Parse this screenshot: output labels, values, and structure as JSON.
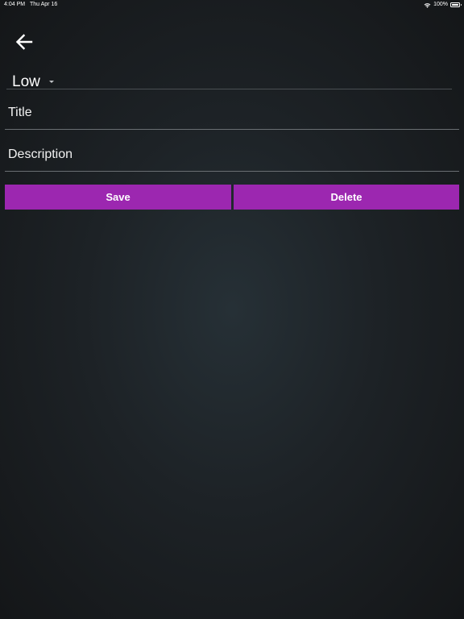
{
  "status_bar": {
    "time": "4:04 PM",
    "date": "Thu Apr 16",
    "battery": "100%",
    "battery_level": 1.0
  },
  "header": {
    "back_icon": "arrow-left-icon"
  },
  "form": {
    "priority": {
      "value": "Low",
      "icon": "caret-down-icon"
    },
    "title": {
      "placeholder": "Title",
      "value": ""
    },
    "description": {
      "placeholder": "Description",
      "value": ""
    }
  },
  "actions": {
    "save_label": "Save",
    "delete_label": "Delete"
  },
  "colors": {
    "accent": "#9c27b0",
    "background": "#1d2226",
    "text": "#ffffff"
  }
}
